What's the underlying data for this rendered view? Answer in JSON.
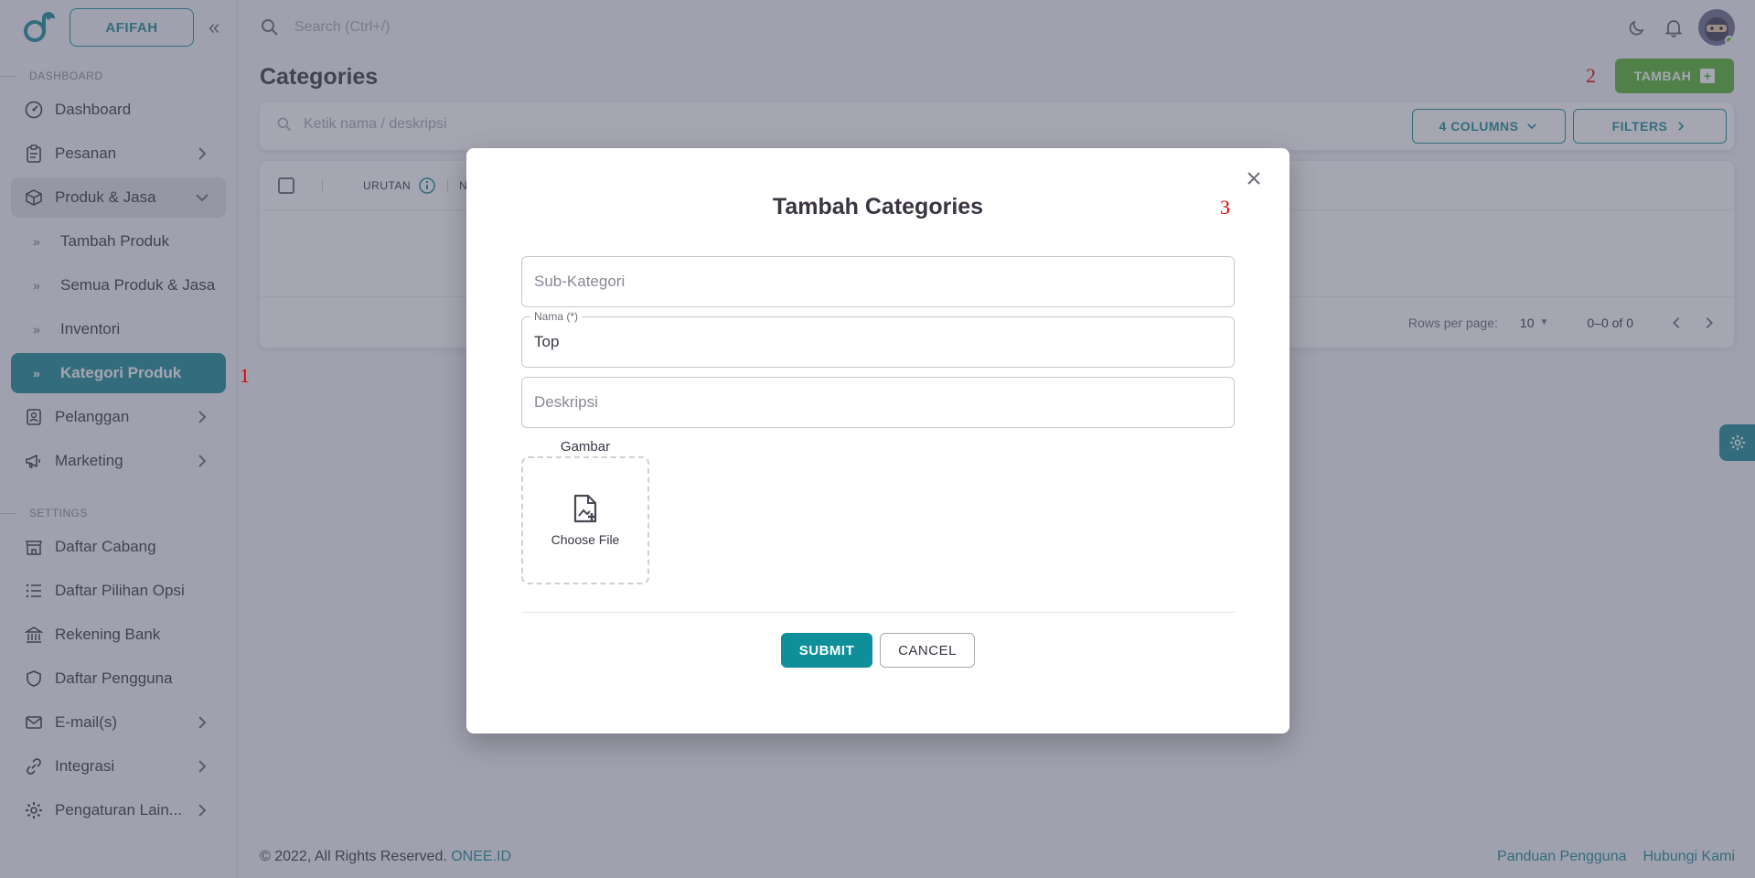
{
  "sidebar": {
    "store_name": "AFIFAH",
    "section_dashboard": "DASHBOARD",
    "section_settings": "SETTINGS",
    "items": [
      {
        "label": "Dashboard"
      },
      {
        "label": "Pesanan"
      },
      {
        "label": "Produk & Jasa"
      },
      {
        "label": "Tambah Produk"
      },
      {
        "label": "Semua Produk & Jasa"
      },
      {
        "label": "Inventori"
      },
      {
        "label": "Kategori Produk"
      },
      {
        "label": "Pelanggan"
      },
      {
        "label": "Marketing"
      }
    ],
    "settings_items": [
      {
        "label": "Daftar Cabang"
      },
      {
        "label": "Daftar Pilihan Opsi"
      },
      {
        "label": "Rekening Bank"
      },
      {
        "label": "Daftar Pengguna"
      },
      {
        "label": "E-mail(s)"
      },
      {
        "label": "Integrasi"
      },
      {
        "label": "Pengaturan Lain..."
      }
    ]
  },
  "topbar": {
    "search_placeholder": "Search (Ctrl+/)"
  },
  "page": {
    "title": "Categories",
    "add_button": "TAMBAH",
    "search_placeholder": "Ketik nama / deskripsi",
    "columns_button": "4 COLUMNS",
    "filters_button": "FILTERS",
    "column_headers": [
      "URUTAN",
      "NA"
    ],
    "rows_per_page_label": "Rows per page:",
    "rows_per_page_value": "10",
    "pagination_text": "0–0 of 0"
  },
  "annotations": {
    "n1": "1",
    "n2": "2",
    "n3": "3"
  },
  "modal": {
    "title": "Tambah Categories",
    "sub_kategori_placeholder": "Sub-Kategori",
    "nama_label": "Nama (*)",
    "nama_value": "Top",
    "deskripsi_placeholder": "Deskripsi",
    "gambar_label": "Gambar",
    "choose_file": "Choose File",
    "submit": "SUBMIT",
    "cancel": "CANCEL"
  },
  "footer": {
    "copyright": "© 2022, All Rights Reserved.",
    "brand_link": "ONEE.ID",
    "guide_link": "Panduan Pengguna",
    "contact_link": "Hubungi Kami"
  },
  "colors": {
    "primary": "#1b8c96",
    "success": "#56b52f",
    "annotation_red": "#e00000"
  }
}
